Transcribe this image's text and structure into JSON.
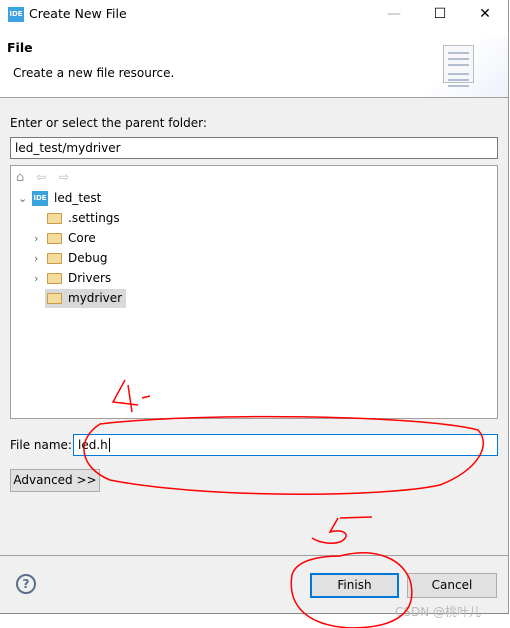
{
  "window": {
    "title": "Create New File",
    "app_icon": "IDE",
    "controls": [
      "minimize",
      "maximize",
      "close"
    ]
  },
  "header": {
    "title": "File",
    "description": "Create a new file resource."
  },
  "folder": {
    "label": "Enter or select the parent folder:",
    "value": "led_test/mydriver"
  },
  "tree": {
    "toolbar": [
      "home-icon",
      "back-icon",
      "forward-icon"
    ],
    "project": "led_test",
    "children": [
      {
        "label": ".settings",
        "expandable": false
      },
      {
        "label": "Core",
        "expandable": true
      },
      {
        "label": "Debug",
        "expandable": true
      },
      {
        "label": "Drivers",
        "expandable": true
      },
      {
        "label": "mydriver",
        "expandable": false,
        "selected": true
      }
    ]
  },
  "file_name": {
    "label": "File name:",
    "value": "led.h"
  },
  "advanced_label": "Advanced >>",
  "buttons": {
    "finish": "Finish",
    "cancel": "Cancel"
  },
  "annotations": {
    "step4": "4",
    "step5": "5",
    "color": "#ff0000"
  },
  "watermark": "CSDN @桃叶儿"
}
